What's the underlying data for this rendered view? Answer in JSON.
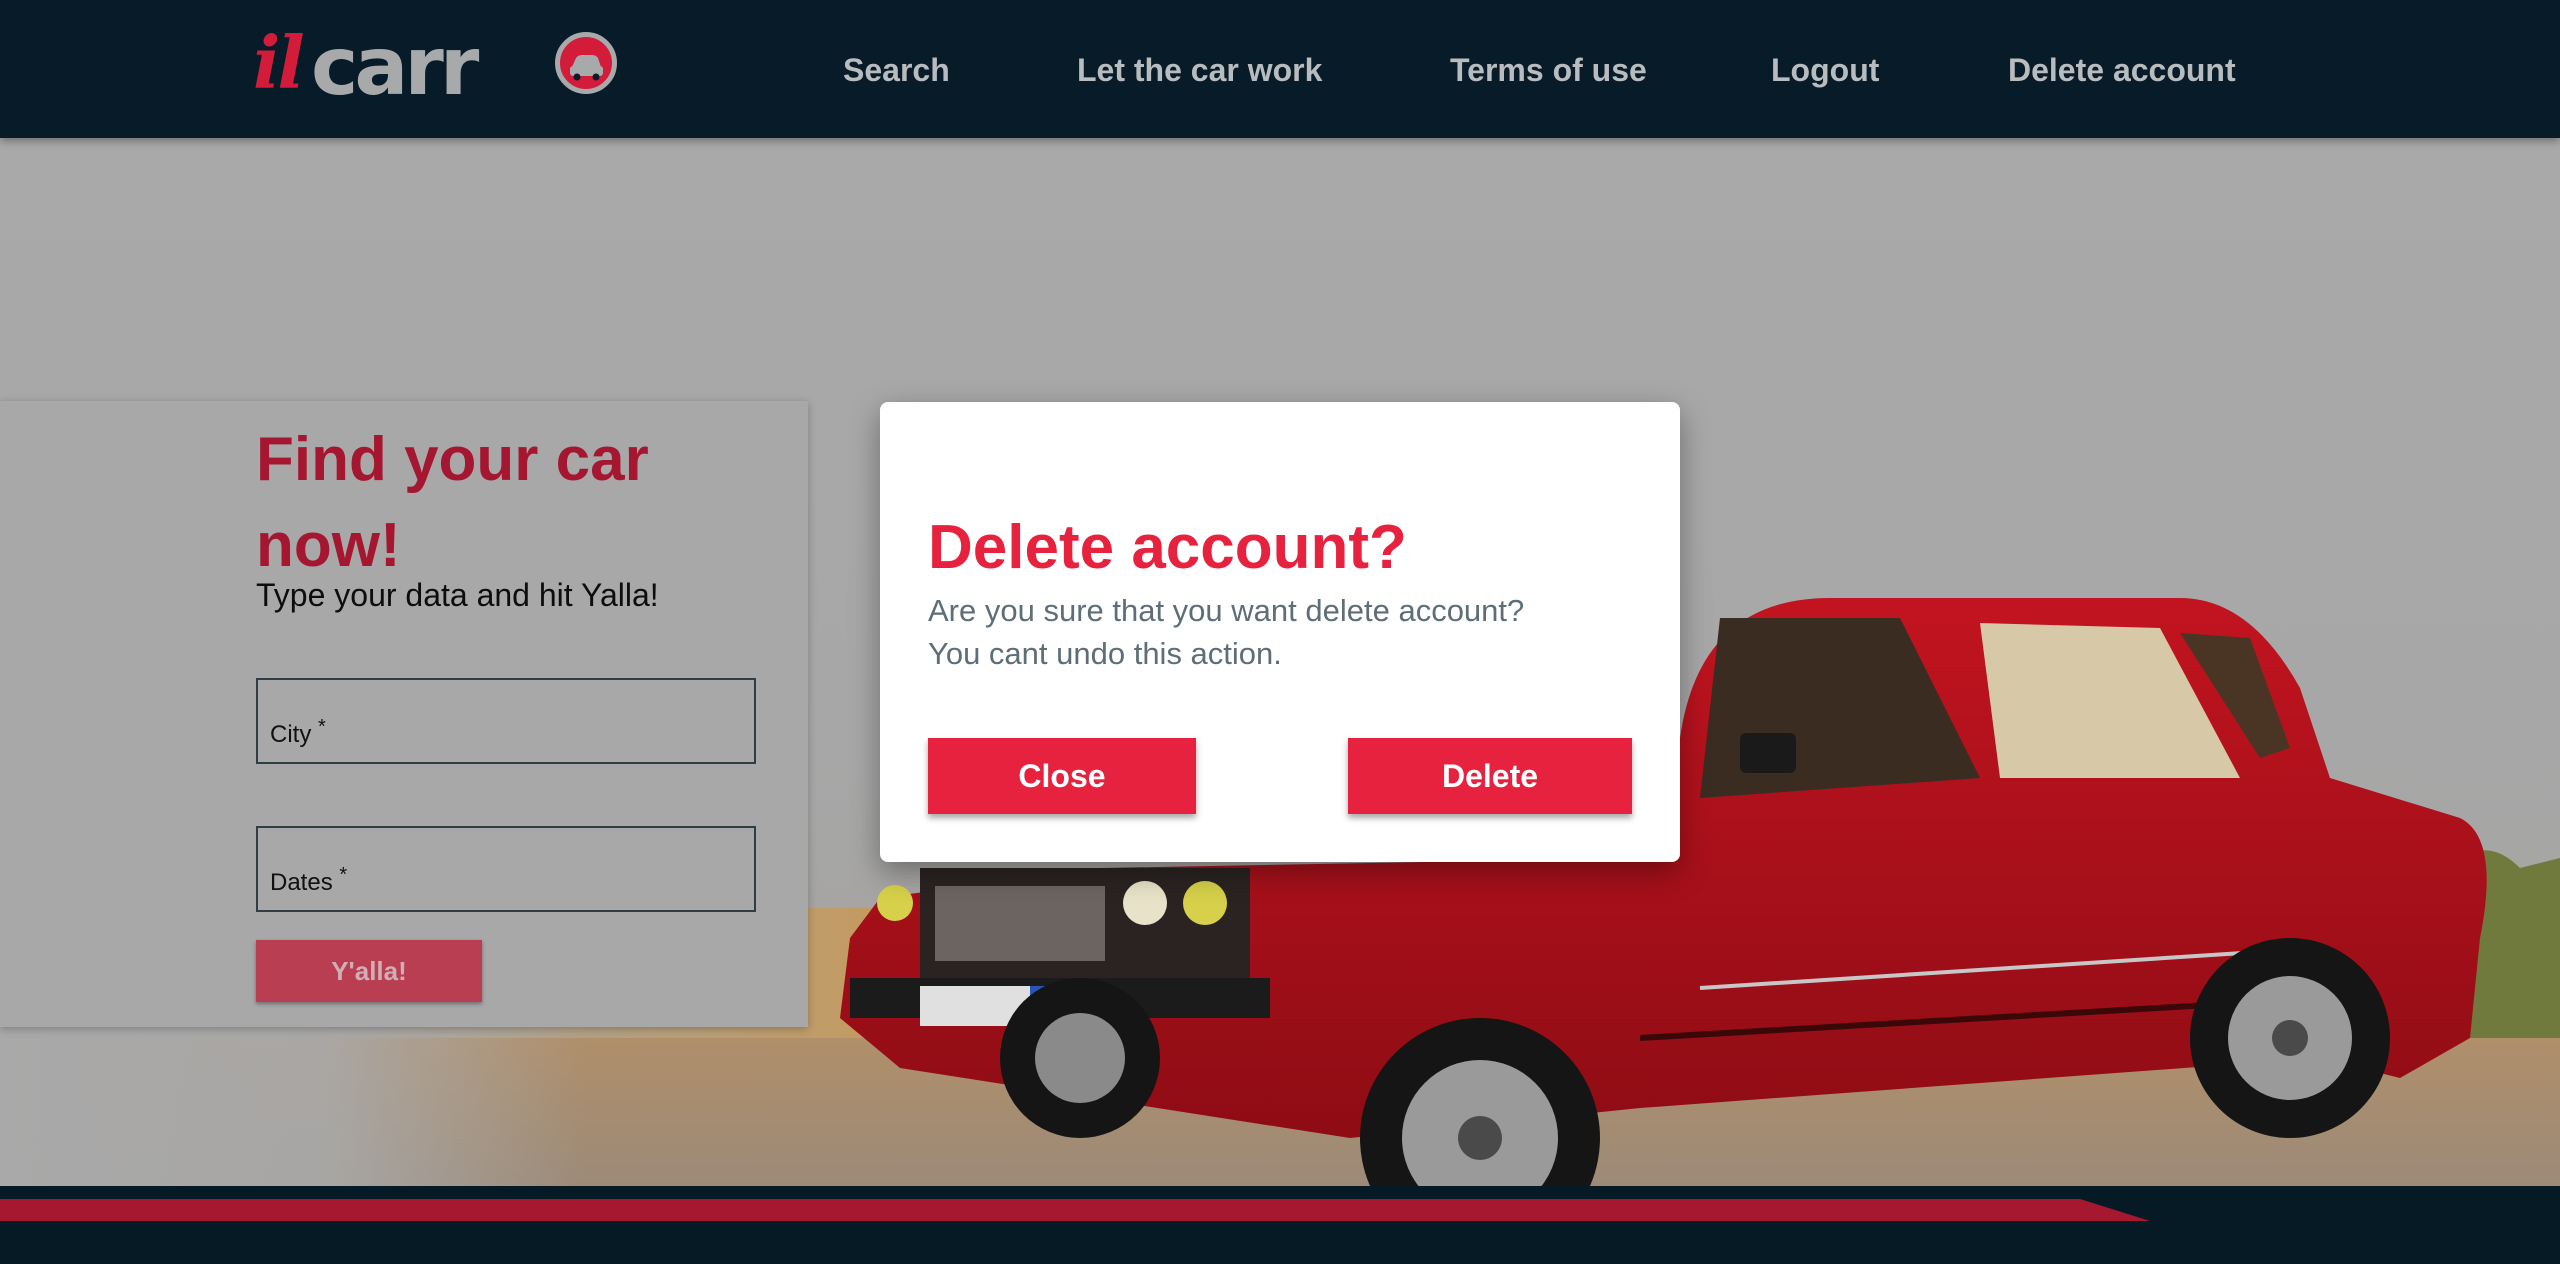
{
  "brand": {
    "logo_text": "ilcarro",
    "accent_color": "#e7223f",
    "header_bg": "#071b28"
  },
  "nav": {
    "items": [
      {
        "label": "Search"
      },
      {
        "label": "Let the car work"
      },
      {
        "label": "Terms of use"
      },
      {
        "label": "Logout"
      },
      {
        "label": "Delete account"
      }
    ]
  },
  "search_card": {
    "title": "Find your car now!",
    "subtitle": "Type your data and hit Yalla!",
    "city_label": "City",
    "dates_label": "Dates",
    "required_mark": "*",
    "submit_label": "Y'alla!"
  },
  "modal": {
    "title": "Delete account?",
    "line1": "Are you sure that you want delete account?",
    "line2": "You cant undo this action.",
    "close_label": "Close",
    "delete_label": "Delete"
  }
}
